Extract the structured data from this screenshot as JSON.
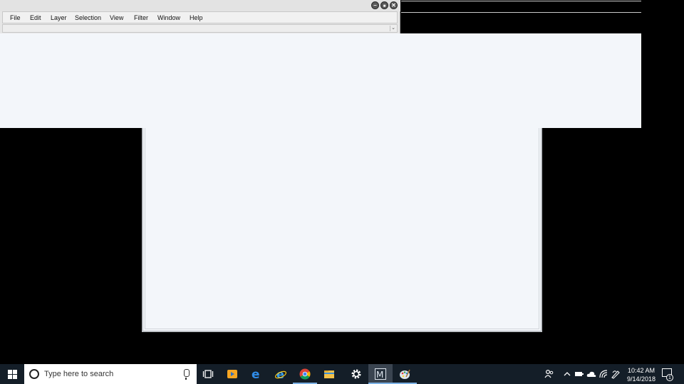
{
  "app": {
    "menu": [
      "File",
      "Edit",
      "Layer",
      "Selection",
      "View",
      "Filter",
      "Window",
      "Help"
    ],
    "window_controls": {
      "minimize": "–",
      "maximize": "■",
      "close": "✕"
    },
    "toolbar_dropdown": "⌄"
  },
  "taskbar": {
    "search_placeholder": "Type here to search",
    "apps": [
      "task-view",
      "media-player",
      "edge",
      "internet-explorer",
      "chrome",
      "file-explorer",
      "settings",
      "m-app",
      "paint-app"
    ],
    "active_app": "m-app",
    "tray": {
      "time": "10:42 AM",
      "date": "9/14/2018",
      "notification_count": "1"
    }
  },
  "colors": {
    "panel_bg": "#f3f6fa",
    "taskbar_bg": "#141e28",
    "accent_underline": "#7bb1e5"
  }
}
